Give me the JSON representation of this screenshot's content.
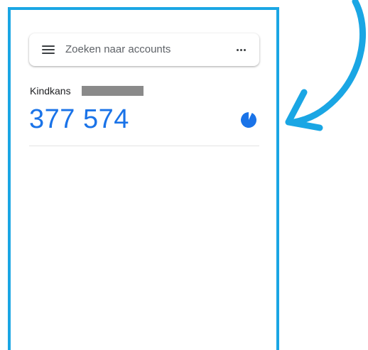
{
  "search": {
    "placeholder": "Zoeken naar accounts"
  },
  "account": {
    "name": "Kindkans",
    "code": "377 574",
    "timer_remaining_fraction": 0.93
  },
  "icons": {
    "menu": "hamburger-menu-icon",
    "more": "more-horizontal-icon",
    "timer": "countdown-timer-icon",
    "arrow": "pointer-arrow-icon"
  },
  "colors": {
    "frame": "#1aa6e4",
    "code": "#1a73e8",
    "timer": "#1a73e8",
    "arrow": "#1aa6e4"
  }
}
